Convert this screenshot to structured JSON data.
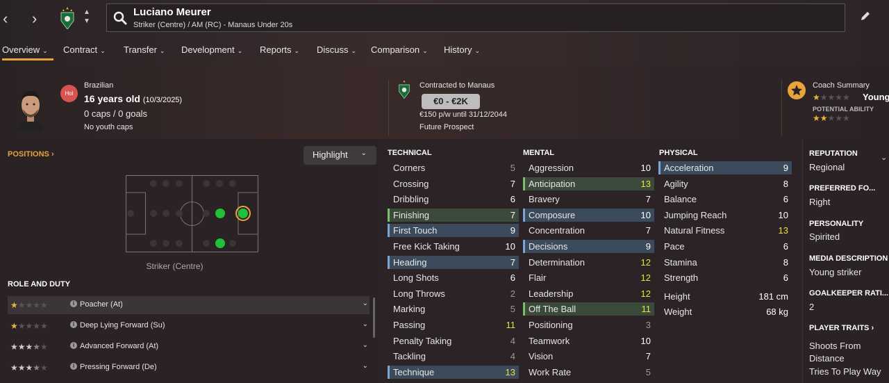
{
  "header": {
    "player_name": "Luciano Meurer",
    "player_subtitle": "Striker (Centre) / AM (RC) - Manaus Under 20s"
  },
  "tabs": [
    {
      "label": "Overview"
    },
    {
      "label": "Contract"
    },
    {
      "label": "Transfer"
    },
    {
      "label": "Development"
    },
    {
      "label": "Reports"
    },
    {
      "label": "Discuss"
    },
    {
      "label": "Comparison"
    },
    {
      "label": "History"
    }
  ],
  "summary": {
    "status_badge": "Hol",
    "nationality": "Brazilian",
    "age": "16 years old",
    "dob": "(10/3/2025)",
    "caps_goals": "0 caps / 0 goals",
    "youth_caps": "No youth caps",
    "contracted_to": "Contracted to Manaus",
    "value_range": "€0 - €2K",
    "wage": "€150 p/w until 31/12/2044",
    "prospect": "Future Prospect",
    "coach_summary_label": "Coach Summary",
    "coach_summary_value": "Young",
    "potential_label": "POTENTIAL ABILITY",
    "current_ability_stars": 1,
    "potential_ability_stars": 2.5
  },
  "positions": {
    "link_label": "POSITIONS",
    "highlight_label": "Highlight",
    "caption": "Striker (Centre)"
  },
  "roles": {
    "heading": "ROLE AND DUTY",
    "items": [
      {
        "name": "Poacher (At)",
        "stars": 1
      },
      {
        "name": "Deep Lying Forward (Su)",
        "stars": 1
      },
      {
        "name": "Advanced Forward (At)",
        "stars": 3.5
      },
      {
        "name": "Pressing Forward (De)",
        "stars": 3.5
      }
    ]
  },
  "technical": {
    "heading": "TECHNICAL",
    "attributes": [
      {
        "name": "Corners",
        "value": "5"
      },
      {
        "name": "Crossing",
        "value": "7"
      },
      {
        "name": "Dribbling",
        "value": "6"
      },
      {
        "name": "Finishing",
        "value": "7"
      },
      {
        "name": "First Touch",
        "value": "9"
      },
      {
        "name": "Free Kick Taking",
        "value": "10"
      },
      {
        "name": "Heading",
        "value": "7"
      },
      {
        "name": "Long Shots",
        "value": "6"
      },
      {
        "name": "Long Throws",
        "value": "2"
      },
      {
        "name": "Marking",
        "value": "5"
      },
      {
        "name": "Passing",
        "value": "11"
      },
      {
        "name": "Penalty Taking",
        "value": "4"
      },
      {
        "name": "Tackling",
        "value": "4"
      },
      {
        "name": "Technique",
        "value": "13"
      }
    ]
  },
  "mental": {
    "heading": "MENTAL",
    "attributes": [
      {
        "name": "Aggression",
        "value": "10"
      },
      {
        "name": "Anticipation",
        "value": "13"
      },
      {
        "name": "Bravery",
        "value": "7"
      },
      {
        "name": "Composure",
        "value": "10"
      },
      {
        "name": "Concentration",
        "value": "7"
      },
      {
        "name": "Decisions",
        "value": "9"
      },
      {
        "name": "Determination",
        "value": "12"
      },
      {
        "name": "Flair",
        "value": "12"
      },
      {
        "name": "Leadership",
        "value": "12"
      },
      {
        "name": "Off The Ball",
        "value": "11"
      },
      {
        "name": "Positioning",
        "value": "3"
      },
      {
        "name": "Teamwork",
        "value": "10"
      },
      {
        "name": "Vision",
        "value": "7"
      },
      {
        "name": "Work Rate",
        "value": "5"
      }
    ]
  },
  "physical": {
    "heading": "PHYSICAL",
    "attributes": [
      {
        "name": "Acceleration",
        "value": "9"
      },
      {
        "name": "Agility",
        "value": "8"
      },
      {
        "name": "Balance",
        "value": "6"
      },
      {
        "name": "Jumping Reach",
        "value": "10"
      },
      {
        "name": "Natural Fitness",
        "value": "13"
      },
      {
        "name": "Pace",
        "value": "6"
      },
      {
        "name": "Stamina",
        "value": "8"
      },
      {
        "name": "Strength",
        "value": "6"
      }
    ],
    "height_label": "Height",
    "height_value": "181 cm",
    "weight_label": "Weight",
    "weight_value": "68 kg"
  },
  "info_panel": {
    "reputation_label": "REPUTATION",
    "reputation_value": "Regional",
    "preferred_foot_label": "PREFERRED FO...",
    "preferred_foot_value": "Right",
    "personality_label": "PERSONALITY",
    "personality_value": "Spirited",
    "media_label": "MEDIA DESCRIPTION",
    "media_value": "Young striker",
    "gk_rating_label": "GOALKEEPER RATI...",
    "gk_rating_value": "2",
    "traits_label": "PLAYER TRAITS",
    "traits": [
      "Shoots From Distance",
      "Tries To Play Way"
    ]
  },
  "colors": {
    "accent": "#e8a33a",
    "attr_white": "#ffffff",
    "attr_yellow": "#e5e53a",
    "attr_grey": "#9a9a9a",
    "highlight_blue": "#3b4b5c",
    "highlight_green": "#3c4a3c",
    "position_green": "#22c03a"
  }
}
